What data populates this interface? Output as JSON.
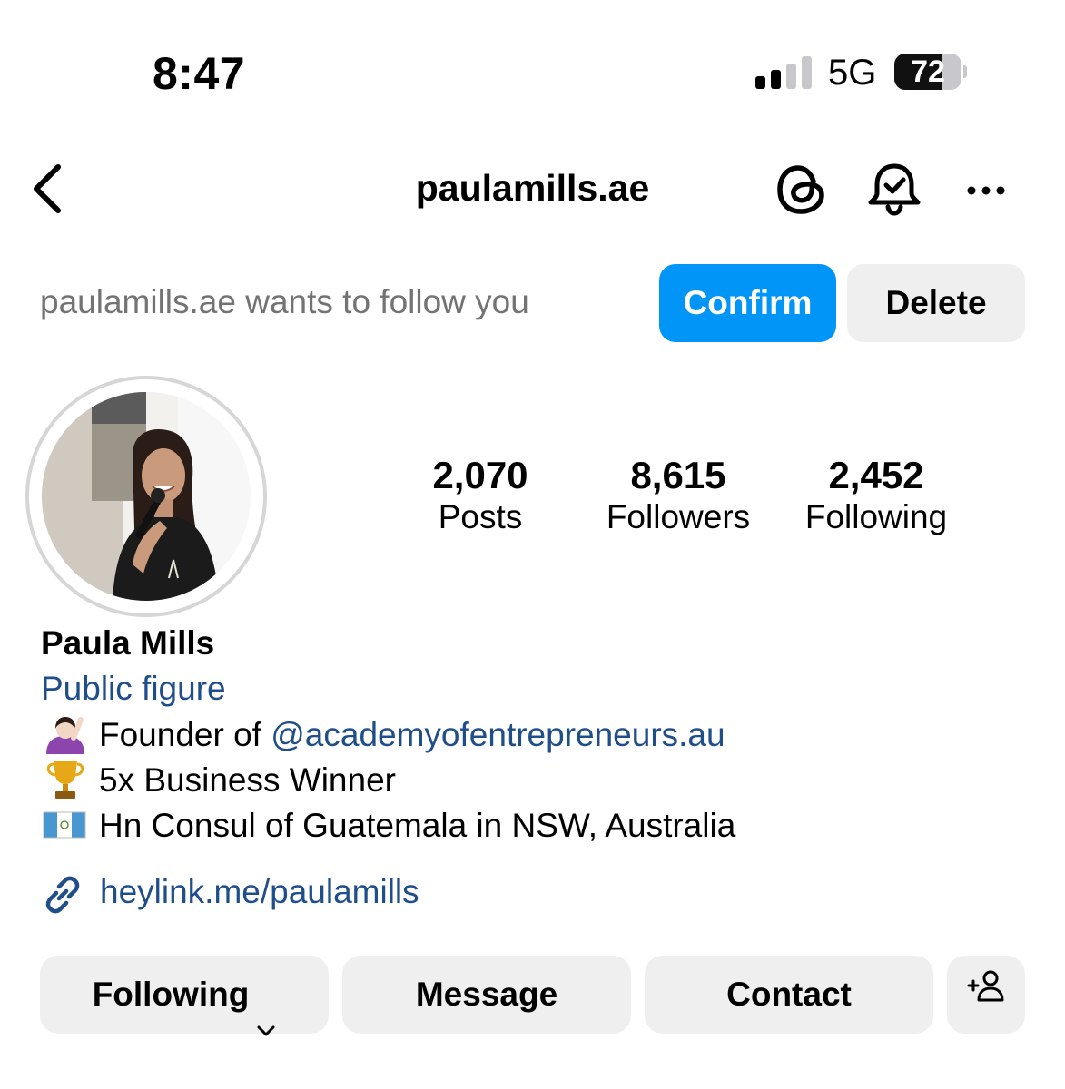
{
  "status_bar": {
    "time": "8:47",
    "network": "5G",
    "battery_percent": "72",
    "battery_level": 0.72,
    "signal_bars_active": 2
  },
  "header": {
    "username": "paulamills.ae",
    "icons": [
      "back-chevron-icon",
      "threads-icon",
      "bell-check-icon",
      "more-dots-icon"
    ]
  },
  "follow_request": {
    "text": "paulamills.ae wants to follow you",
    "confirm_label": "Confirm",
    "delete_label": "Delete"
  },
  "stats": {
    "posts": {
      "value": "2,070",
      "label": "Posts"
    },
    "followers": {
      "value": "8,615",
      "label": "Followers"
    },
    "following": {
      "value": "2,452",
      "label": "Following"
    }
  },
  "profile": {
    "name": "Paula Mills",
    "category": "Public figure",
    "bio": {
      "line1_prefix": "Founder of ",
      "line1_mention": "@academyofentrepreneurs.au",
      "line2": "5x Business Winner",
      "line3": "Hn Consul of Guatemala in NSW, Australia"
    },
    "bio_emoji_icons": [
      "raising-hand-icon",
      "trophy-icon",
      "guatemala-flag-icon"
    ],
    "link": "heylink.me/paulamills"
  },
  "actions": {
    "following_label": "Following",
    "message_label": "Message",
    "contact_label": "Contact",
    "add_person_icon": "add-person-icon"
  },
  "colors": {
    "accent_blue": "#0095f6",
    "link_blue": "#1f4e8a",
    "button_gray": "#efefef",
    "secondary_text": "#737373"
  }
}
